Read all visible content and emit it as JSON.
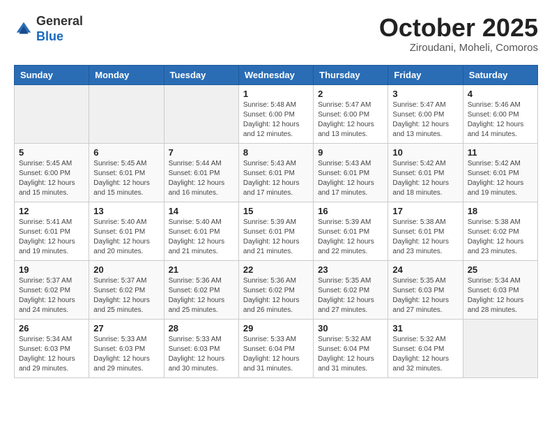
{
  "header": {
    "logo_general": "General",
    "logo_blue": "Blue",
    "month_title": "October 2025",
    "subtitle": "Ziroudani, Moheli, Comoros"
  },
  "weekdays": [
    "Sunday",
    "Monday",
    "Tuesday",
    "Wednesday",
    "Thursday",
    "Friday",
    "Saturday"
  ],
  "weeks": [
    [
      {
        "day": "",
        "info": ""
      },
      {
        "day": "",
        "info": ""
      },
      {
        "day": "",
        "info": ""
      },
      {
        "day": "1",
        "info": "Sunrise: 5:48 AM\nSunset: 6:00 PM\nDaylight: 12 hours\nand 12 minutes."
      },
      {
        "day": "2",
        "info": "Sunrise: 5:47 AM\nSunset: 6:00 PM\nDaylight: 12 hours\nand 13 minutes."
      },
      {
        "day": "3",
        "info": "Sunrise: 5:47 AM\nSunset: 6:00 PM\nDaylight: 12 hours\nand 13 minutes."
      },
      {
        "day": "4",
        "info": "Sunrise: 5:46 AM\nSunset: 6:00 PM\nDaylight: 12 hours\nand 14 minutes."
      }
    ],
    [
      {
        "day": "5",
        "info": "Sunrise: 5:45 AM\nSunset: 6:00 PM\nDaylight: 12 hours\nand 15 minutes."
      },
      {
        "day": "6",
        "info": "Sunrise: 5:45 AM\nSunset: 6:01 PM\nDaylight: 12 hours\nand 15 minutes."
      },
      {
        "day": "7",
        "info": "Sunrise: 5:44 AM\nSunset: 6:01 PM\nDaylight: 12 hours\nand 16 minutes."
      },
      {
        "day": "8",
        "info": "Sunrise: 5:43 AM\nSunset: 6:01 PM\nDaylight: 12 hours\nand 17 minutes."
      },
      {
        "day": "9",
        "info": "Sunrise: 5:43 AM\nSunset: 6:01 PM\nDaylight: 12 hours\nand 17 minutes."
      },
      {
        "day": "10",
        "info": "Sunrise: 5:42 AM\nSunset: 6:01 PM\nDaylight: 12 hours\nand 18 minutes."
      },
      {
        "day": "11",
        "info": "Sunrise: 5:42 AM\nSunset: 6:01 PM\nDaylight: 12 hours\nand 19 minutes."
      }
    ],
    [
      {
        "day": "12",
        "info": "Sunrise: 5:41 AM\nSunset: 6:01 PM\nDaylight: 12 hours\nand 19 minutes."
      },
      {
        "day": "13",
        "info": "Sunrise: 5:40 AM\nSunset: 6:01 PM\nDaylight: 12 hours\nand 20 minutes."
      },
      {
        "day": "14",
        "info": "Sunrise: 5:40 AM\nSunset: 6:01 PM\nDaylight: 12 hours\nand 21 minutes."
      },
      {
        "day": "15",
        "info": "Sunrise: 5:39 AM\nSunset: 6:01 PM\nDaylight: 12 hours\nand 21 minutes."
      },
      {
        "day": "16",
        "info": "Sunrise: 5:39 AM\nSunset: 6:01 PM\nDaylight: 12 hours\nand 22 minutes."
      },
      {
        "day": "17",
        "info": "Sunrise: 5:38 AM\nSunset: 6:01 PM\nDaylight: 12 hours\nand 23 minutes."
      },
      {
        "day": "18",
        "info": "Sunrise: 5:38 AM\nSunset: 6:02 PM\nDaylight: 12 hours\nand 23 minutes."
      }
    ],
    [
      {
        "day": "19",
        "info": "Sunrise: 5:37 AM\nSunset: 6:02 PM\nDaylight: 12 hours\nand 24 minutes."
      },
      {
        "day": "20",
        "info": "Sunrise: 5:37 AM\nSunset: 6:02 PM\nDaylight: 12 hours\nand 25 minutes."
      },
      {
        "day": "21",
        "info": "Sunrise: 5:36 AM\nSunset: 6:02 PM\nDaylight: 12 hours\nand 25 minutes."
      },
      {
        "day": "22",
        "info": "Sunrise: 5:36 AM\nSunset: 6:02 PM\nDaylight: 12 hours\nand 26 minutes."
      },
      {
        "day": "23",
        "info": "Sunrise: 5:35 AM\nSunset: 6:02 PM\nDaylight: 12 hours\nand 27 minutes."
      },
      {
        "day": "24",
        "info": "Sunrise: 5:35 AM\nSunset: 6:03 PM\nDaylight: 12 hours\nand 27 minutes."
      },
      {
        "day": "25",
        "info": "Sunrise: 5:34 AM\nSunset: 6:03 PM\nDaylight: 12 hours\nand 28 minutes."
      }
    ],
    [
      {
        "day": "26",
        "info": "Sunrise: 5:34 AM\nSunset: 6:03 PM\nDaylight: 12 hours\nand 29 minutes."
      },
      {
        "day": "27",
        "info": "Sunrise: 5:33 AM\nSunset: 6:03 PM\nDaylight: 12 hours\nand 29 minutes."
      },
      {
        "day": "28",
        "info": "Sunrise: 5:33 AM\nSunset: 6:03 PM\nDaylight: 12 hours\nand 30 minutes."
      },
      {
        "day": "29",
        "info": "Sunrise: 5:33 AM\nSunset: 6:04 PM\nDaylight: 12 hours\nand 31 minutes."
      },
      {
        "day": "30",
        "info": "Sunrise: 5:32 AM\nSunset: 6:04 PM\nDaylight: 12 hours\nand 31 minutes."
      },
      {
        "day": "31",
        "info": "Sunrise: 5:32 AM\nSunset: 6:04 PM\nDaylight: 12 hours\nand 32 minutes."
      },
      {
        "day": "",
        "info": ""
      }
    ]
  ]
}
